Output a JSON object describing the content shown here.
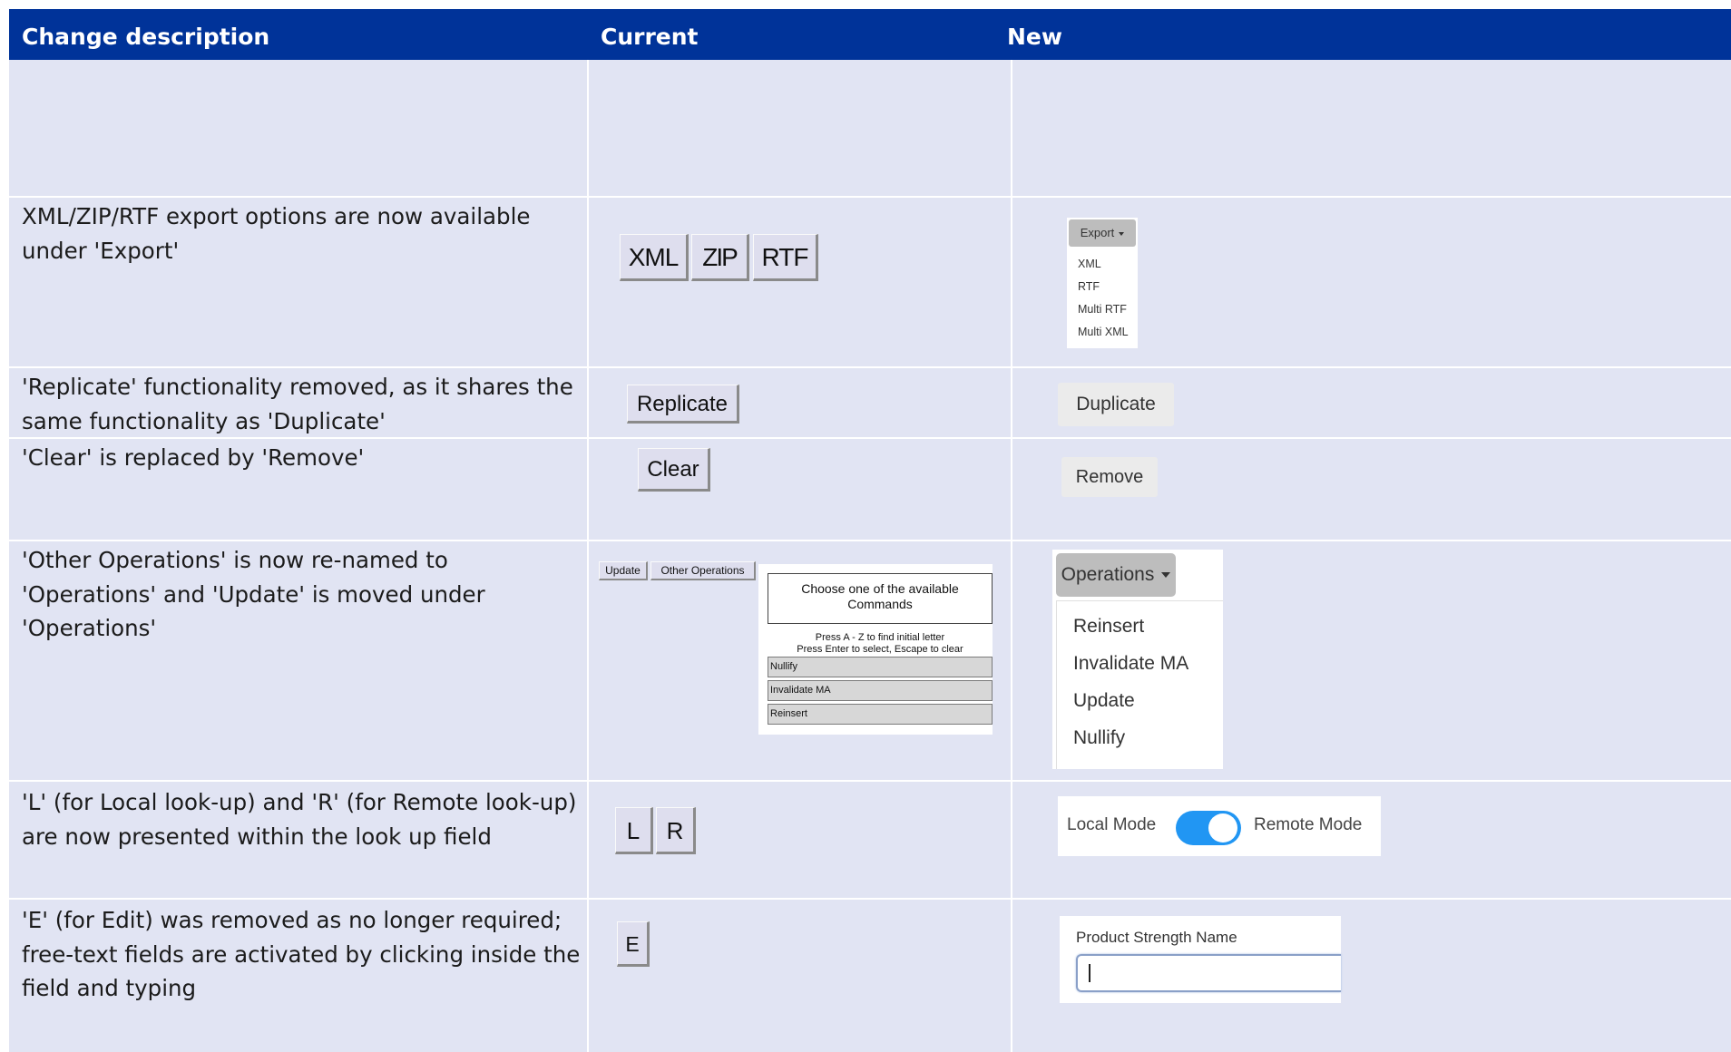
{
  "header": {
    "col1": "Change description",
    "col2": "Current",
    "col3": "New"
  },
  "rows": {
    "export": {
      "description": "XML/ZIP/RTF export options are now available under 'Export'",
      "current_buttons": [
        "XML",
        "ZIP",
        "RTF"
      ],
      "new_button": "Export",
      "new_menu": [
        "XML",
        "RTF",
        "Multi RTF",
        "Multi XML"
      ]
    },
    "replicate": {
      "description": "'Replicate' functionality removed, as it shares the same functionality as 'Duplicate'",
      "current_button": "Replicate",
      "new_button": "Duplicate"
    },
    "clear": {
      "description": "'Clear' is replaced by 'Remove'",
      "current_button": "Clear",
      "new_button": "Remove"
    },
    "operations": {
      "description": "'Other Operations' is now re-named to 'Operations' and 'Update' is moved under 'Operations'",
      "current_buttons": [
        "Update",
        "Other Operations"
      ],
      "dialog_title": "Choose one of the available Commands",
      "dialog_hint": "Press A - Z to find initial letter\nPress Enter to select, Escape to clear",
      "current_commands": [
        "Nullify",
        "Invalidate MA",
        "Reinsert"
      ],
      "new_button": "Operations",
      "new_menu": [
        "Reinsert",
        "Invalidate MA",
        "Update",
        "Nullify"
      ]
    },
    "lookup": {
      "description": "'L' (for Local look-up) and 'R' (for Remote look-up) are now presented within the look up field",
      "current_buttons": [
        "L",
        "R"
      ],
      "local_label": "Local Mode",
      "remote_label": "Remote Mode",
      "toggle_on": true
    },
    "edit": {
      "description": "'E' (for Edit) was removed as no longer required; free-text fields are activated by clicking inside the field and typing",
      "current_button": "E",
      "field_label": "Product Strength Name",
      "field_value": ""
    }
  },
  "colors": {
    "header_bg": "#003399",
    "row_bg": "#e1e4f3",
    "toggle_blue": "#2196f3"
  }
}
